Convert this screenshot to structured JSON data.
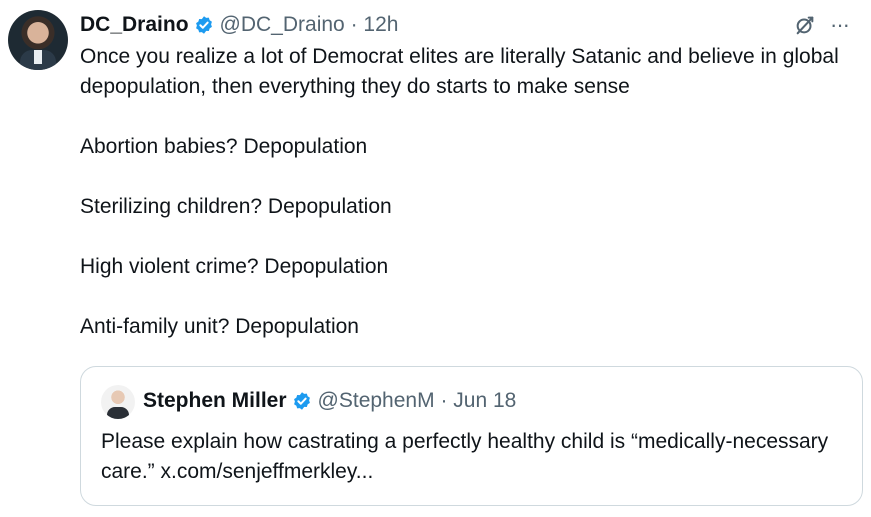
{
  "tweet": {
    "display_name": "DC_Draino",
    "handle": "@DC_Draino",
    "separator": "·",
    "time": "12h",
    "paragraphs": [
      "Once you realize a lot of Democrat elites are literally Satanic and believe in global depopulation, then everything they do starts to make sense",
      "Abortion babies? Depopulation",
      "Sterilizing children? Depopulation",
      "High violent crime? Depopulation",
      "Anti-family unit? Depopulation"
    ],
    "more_label": "···",
    "icons": {
      "verified": "verified-badge-icon",
      "grok": "grok-icon",
      "more": "more-icon"
    }
  },
  "quote": {
    "display_name": "Stephen Miller",
    "handle": "@StephenM",
    "separator": "·",
    "time": "Jun 18",
    "text": "Please explain how castrating a perfectly healthy child is “medically-necessary care.” x.com/senjeffmerkley..."
  },
  "colors": {
    "text": "#0f1419",
    "secondary": "#536471",
    "verified": "#1d9bf0",
    "border": "#cfd9de"
  }
}
